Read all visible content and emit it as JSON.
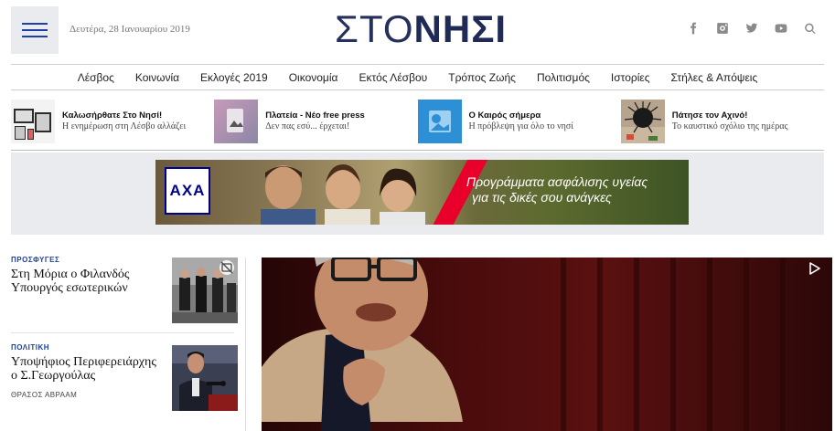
{
  "header": {
    "date": "Δευτέρα, 28 Ιανουαρίου 2019",
    "logo_thin": "ΣΤΟ",
    "logo_bold": "ΝΗΣΙ",
    "social_icons": [
      "facebook-icon",
      "instagram-icon",
      "twitter-icon",
      "youtube-icon",
      "search-icon"
    ]
  },
  "nav": {
    "items": [
      "Λέσβος",
      "Κοινωνία",
      "Εκλογές 2019",
      "Οικονομία",
      "Εκτός Λέσβου",
      "Τρόπος Ζωής",
      "Πολιτισμός",
      "Ιστορίες",
      "Στήλες & Απόψεις"
    ]
  },
  "promos": [
    {
      "title": "Καλωσήρθατε Στο Νησί!",
      "subtitle": "Η ενημέρωση στη Λέσβο αλλάζει"
    },
    {
      "title": "Πλατεία - Νέο free press",
      "subtitle": "Δεν πας εσύ... έρχεται!"
    },
    {
      "title": "Ο Καιρός σήμερα",
      "subtitle": "Η πρόβλεψη για όλο το νησί"
    },
    {
      "title": "Πάτησε τον Αχινό!",
      "subtitle": "Το καυστικό σχόλιο της ημέρας"
    }
  ],
  "ad": {
    "brand": "AXA",
    "line1": "Προγράμματα ασφάλισης υγείας",
    "line2": "για τις δικές σου ανάγκες"
  },
  "articles": [
    {
      "category": "ΠΡΟΣΦΥΓΕΣ",
      "title": "Στη Μόρια ο Φιλανδός Υπουργός εσωτερικών",
      "author": ""
    },
    {
      "category": "ΠΟΛΙΤΙΚΗ",
      "title": "Υποψήφιος Περιφερειάρχης ο Σ.Γεωργούλας",
      "author": "ΘΡΑΣΟΣ ΑΒΡΑΑΜ"
    }
  ],
  "colors": {
    "accent": "#1d3fa8",
    "logo": "#1f2a56",
    "axa_red": "#e8002a",
    "axa_blue": "#00008f"
  }
}
